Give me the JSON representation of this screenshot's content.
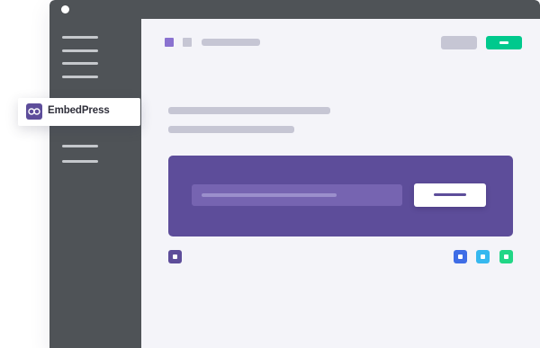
{
  "brand": {
    "name": "EmbedPress",
    "logo_icon": "infinity-link-icon"
  },
  "colors": {
    "sidebar": "#4f5357",
    "page": "#f4f4f9",
    "accent": "#5d4d9a",
    "green": "#00c98d",
    "gray_button": "#c6c6d4"
  },
  "sidebar": {
    "menu_line_count": 6
  },
  "toolbar": {
    "indicators": [
      "purple-square-icon",
      "gray-square-icon"
    ],
    "gray_button_icon": "placeholder-button",
    "green_button_icon": "minus-icon"
  },
  "embed": {
    "field_icon": "url-input-placeholder",
    "submit_icon": "submit-bar-icon"
  },
  "chips": [
    {
      "name": "purple-chip",
      "color": "#5d4d9a"
    },
    {
      "name": "blue-chip",
      "color": "#3f6de6"
    },
    {
      "name": "cyan-chip",
      "color": "#36b8ef"
    },
    {
      "name": "green-chip",
      "color": "#21d686"
    }
  ]
}
